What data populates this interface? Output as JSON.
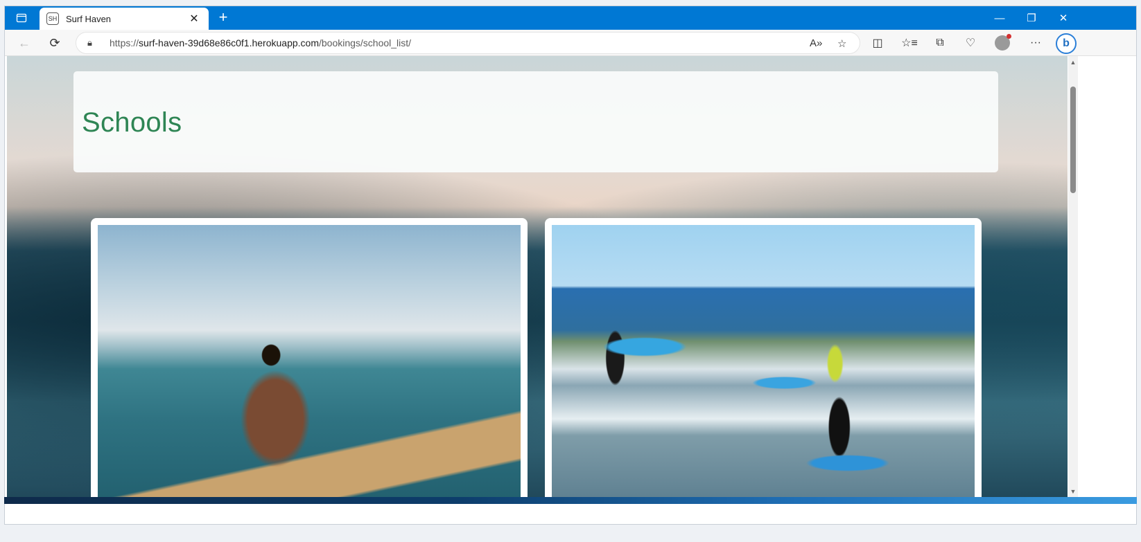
{
  "browser": {
    "tab": {
      "title": "Surf Haven",
      "favicon_text": "SH"
    },
    "new_tab_label": "+",
    "window_controls": {
      "minimize": "—",
      "restore": "❐",
      "close": "✕"
    },
    "address": {
      "scheme": "https://",
      "host": "surf-haven-39d68e86c0f1.herokuapp.com",
      "path": "/bookings/school_list/"
    },
    "icons": [
      "back-icon",
      "refresh-icon",
      "lock-icon",
      "read-aloud-icon",
      "favorite-icon",
      "split-screen-icon",
      "favorites-icon",
      "collections-icon",
      "browser-essentials-icon",
      "profile-avatar",
      "more-icon",
      "bing-icon"
    ]
  },
  "page": {
    "title": "Schools",
    "cards": [
      {
        "image_description_icon": "surfer-woman-image"
      },
      {
        "image_description_icon": "surf-lesson-image"
      }
    ]
  },
  "colors": {
    "accent_title": "#2e8554",
    "browser_chrome": "#0078d4"
  }
}
